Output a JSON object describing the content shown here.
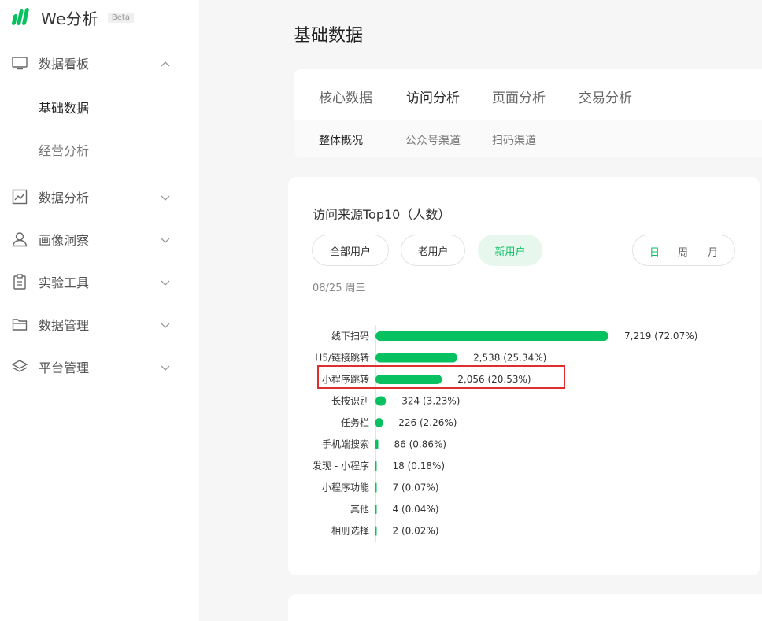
{
  "brand": {
    "name": "We分析",
    "badge": "Beta"
  },
  "sidebar": {
    "items": [
      {
        "label": "数据看板",
        "icon": "monitor-icon",
        "expanded": true,
        "children": [
          {
            "label": "基础数据",
            "active": true
          },
          {
            "label": "经营分析",
            "active": false
          }
        ]
      },
      {
        "label": "数据分析",
        "icon": "line-chart-icon",
        "expanded": false
      },
      {
        "label": "画像洞察",
        "icon": "user-portrait-icon",
        "expanded": false
      },
      {
        "label": "实验工具",
        "icon": "clipboard-icon",
        "expanded": false
      },
      {
        "label": "数据管理",
        "icon": "folder-icon",
        "expanded": false
      },
      {
        "label": "平台管理",
        "icon": "layers-icon",
        "expanded": false
      }
    ]
  },
  "page": {
    "title": "基础数据"
  },
  "tabs": [
    {
      "label": "核心数据",
      "active": false
    },
    {
      "label": "访问分析",
      "active": true
    },
    {
      "label": "页面分析",
      "active": false
    },
    {
      "label": "交易分析",
      "active": false
    }
  ],
  "subtabs": [
    {
      "label": "整体概况",
      "active": true
    },
    {
      "label": "公众号渠道",
      "active": false
    },
    {
      "label": "扫码渠道",
      "active": false
    }
  ],
  "card": {
    "title": "访问来源Top10（人数）",
    "filters": [
      {
        "label": "全部用户",
        "active": false
      },
      {
        "label": "老用户",
        "active": false
      },
      {
        "label": "新用户",
        "active": true
      }
    ],
    "periods": [
      {
        "label": "日",
        "active": true
      },
      {
        "label": "周",
        "active": false
      },
      {
        "label": "月",
        "active": false
      }
    ],
    "date": "08/25 周三"
  },
  "colors": {
    "accent": "#07c160",
    "highlight": "#e02e2e"
  },
  "chart_data": {
    "type": "bar",
    "orientation": "horizontal",
    "title": "访问来源Top10（人数）",
    "categories": [
      "线下扫码",
      "H5/链接跳转",
      "小程序跳转",
      "长按识别",
      "任务栏",
      "手机端搜索",
      "发现 - 小程序",
      "小程序功能",
      "其他",
      "相册选择"
    ],
    "values": [
      7219,
      2538,
      2056,
      324,
      226,
      86,
      18,
      7,
      4,
      2
    ],
    "percents": [
      72.07,
      25.34,
      20.53,
      3.23,
      2.26,
      0.86,
      0.18,
      0.07,
      0.04,
      0.02
    ],
    "value_labels": [
      "7,219 (72.07%)",
      "2,538 (25.34%)",
      "2,056 (20.53%)",
      "324 (3.23%)",
      "226 (2.26%)",
      "86 (0.86%)",
      "18 (0.18%)",
      "7 (0.07%)",
      "4 (0.04%)",
      "2 (0.02%)"
    ],
    "highlighted_category": "小程序跳转",
    "xlim": [
      0,
      7219
    ]
  }
}
